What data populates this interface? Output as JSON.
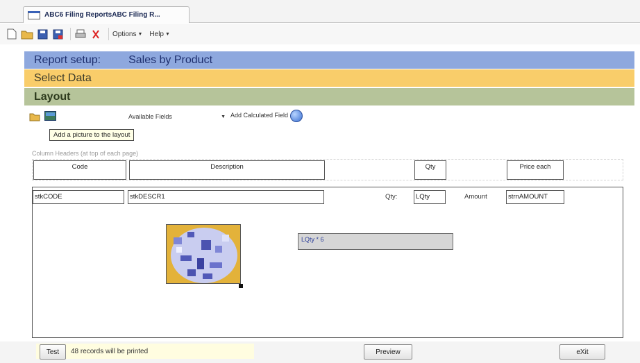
{
  "tab": {
    "title": "ABC6 Filing ReportsABC Filing R..."
  },
  "toolbar": {
    "options_label": "Options",
    "help_label": "Help"
  },
  "sections": {
    "report_setup_label": "Report setup:",
    "report_setup_value": "Sales by Product",
    "select_data_label": "Select Data",
    "layout_label": "Layout"
  },
  "layout_toolbar": {
    "available_fields": "Available Fields",
    "add_calculated_field": "Add Calculated Field",
    "tooltip": "Add a picture to the layout"
  },
  "column_headers": {
    "caption": "Column Headers (at top of each page)",
    "code": "Code",
    "description": "Description",
    "qty": "Qty",
    "price_each": "Price each"
  },
  "detail": {
    "code_field": "stkCODE",
    "descr_field": "stkDESCR1",
    "qty_label": "Qty:",
    "qty_field": "LQty",
    "amount_label": "Amount",
    "amount_field": "strnAMOUNT",
    "calc_expression": "LQty * 6"
  },
  "footer": {
    "test_label": "Test",
    "status": "48 records will be printed",
    "preview_label": "Preview",
    "exit_label": "eXit"
  },
  "colors": {
    "report_band": "#8ea8de",
    "select_band": "#f9cd6a",
    "layout_band": "#b6c49a"
  }
}
